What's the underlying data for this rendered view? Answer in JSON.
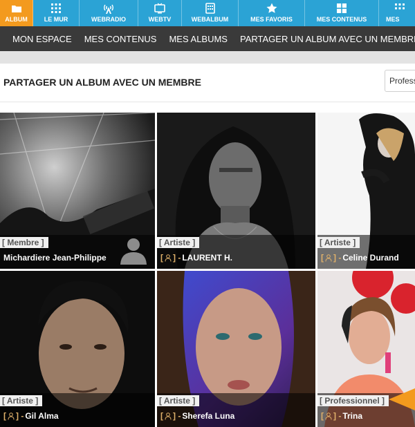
{
  "topnav": {
    "items": [
      {
        "label": "ALBUM",
        "icon": "folder-icon",
        "active": true
      },
      {
        "label": "LE MUR",
        "icon": "grid-dots-icon"
      },
      {
        "label": "WEBRADIO",
        "icon": "radio-antenna-icon"
      },
      {
        "label": "WEBTV",
        "icon": "tv-icon"
      },
      {
        "label": "WEBALBUM",
        "icon": "album-icon"
      },
      {
        "label": "MES FAVORIS",
        "icon": "star-icon"
      },
      {
        "label": "MES CONTENUS",
        "icon": "windows-icon"
      },
      {
        "label": "MES",
        "icon": "grid-dots-icon"
      }
    ]
  },
  "breadcrumb": {
    "home_icon": "home-icon",
    "items": [
      "MON ESPACE",
      "MES CONTENUS",
      "MES ALBUMS",
      "PARTAGER UN ALBUM AVEC UN MEMBRE"
    ]
  },
  "page": {
    "title": "PARTAGER UN ALBUM AVEC UN MEMBRE",
    "filter_value": "Professionnel"
  },
  "members": [
    {
      "badge": "[ Membre ]",
      "name": "Michardiere Jean-Philippe",
      "pro": false,
      "pro_label": ""
    },
    {
      "badge": "[ Artiste ]",
      "name": "LAURENT H.",
      "pro": true,
      "pro_label": "[ ] -"
    },
    {
      "badge": "[ Artiste ]",
      "name": "Celine Durand",
      "pro": true,
      "pro_label": "[ ] -"
    },
    {
      "badge": "[ Artiste ]",
      "name": "Gil Alma",
      "pro": true,
      "pro_label": "[ ] -"
    },
    {
      "badge": "[ Artiste ]",
      "name": "Sherefa Luna",
      "pro": true,
      "pro_label": "[ ] -"
    },
    {
      "badge": "[ Professionnel ]",
      "name": "Trina",
      "pro": true,
      "pro_label": "[ ] -"
    }
  ],
  "colors": {
    "nav_blue": "#2ba3d5",
    "nav_active": "#f39a1e",
    "breadcrumb_bg": "#3a3a3a",
    "pro_gold": "#e0b16a"
  }
}
